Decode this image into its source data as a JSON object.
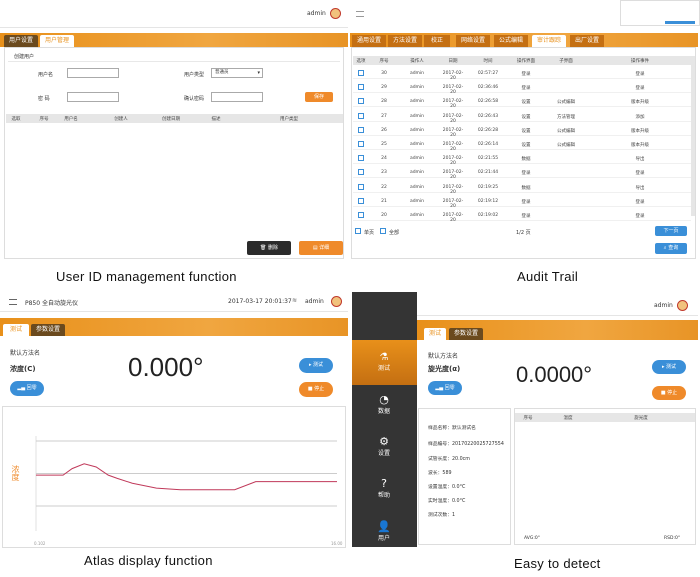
{
  "q1": {
    "user": "admin",
    "tabs": [
      "用户设置",
      "用户管理"
    ],
    "form_title": "创建用户",
    "fields": {
      "username": "用户名",
      "user_type": "用户类型",
      "user_type_value": "普通员",
      "password": "密 码",
      "confirm": "确认密码"
    },
    "save_label": "保存",
    "headers": [
      "选取",
      "序号",
      "用户名",
      "创建人",
      "创建日期",
      "描述",
      "用户类型"
    ],
    "delete_label": "删除",
    "detail_label": "详细",
    "caption": "User ID management function"
  },
  "q2": {
    "tabs": [
      "通用设置",
      "方法设置",
      "校正",
      "网络设置",
      "公式编辑",
      "审计跟踪",
      "出厂设置"
    ],
    "headers": [
      "选项",
      "序号",
      "操作人",
      "日期",
      "时间",
      "操作界面",
      "子界面",
      "操作事件"
    ],
    "rows": [
      {
        "n": "30",
        "u": "admin",
        "d": "2017-02-20",
        "t": "02:57:27",
        "s": "登录",
        "sub": "",
        "e": "登录"
      },
      {
        "n": "29",
        "u": "admin",
        "d": "2017-02-20",
        "t": "02:36:46",
        "s": "登录",
        "sub": "",
        "e": "登录"
      },
      {
        "n": "28",
        "u": "admin",
        "d": "2017-02-20",
        "t": "02:26:58",
        "s": "设置",
        "sub": "公式编辑",
        "e": "版本升级"
      },
      {
        "n": "27",
        "u": "admin",
        "d": "2017-02-20",
        "t": "02:26:43",
        "s": "设置",
        "sub": "方法管理",
        "e": "添加"
      },
      {
        "n": "26",
        "u": "admin",
        "d": "2017-02-20",
        "t": "02:26:28",
        "s": "设置",
        "sub": "公式编辑",
        "e": "版本升级"
      },
      {
        "n": "25",
        "u": "admin",
        "d": "2017-02-20",
        "t": "02:26:14",
        "s": "设置",
        "sub": "公式编辑",
        "e": "版本升级"
      },
      {
        "n": "24",
        "u": "admin",
        "d": "2017-02-20",
        "t": "02:21:55",
        "s": "数据",
        "sub": "",
        "e": "导出"
      },
      {
        "n": "23",
        "u": "admin",
        "d": "2017-02-20",
        "t": "02:21:44",
        "s": "登录",
        "sub": "",
        "e": "登录"
      },
      {
        "n": "22",
        "u": "admin",
        "d": "2017-02-20",
        "t": "02:19:25",
        "s": "数据",
        "sub": "",
        "e": "导出"
      },
      {
        "n": "21",
        "u": "admin",
        "d": "2017-02-20",
        "t": "02:19:12",
        "s": "登录",
        "sub": "",
        "e": "登录"
      },
      {
        "n": "20",
        "u": "admin",
        "d": "2017-02-20",
        "t": "02:19:02",
        "s": "登录",
        "sub": "",
        "e": "登录"
      }
    ],
    "single_page": "单页",
    "all_label": "全部",
    "page": "1/2 页",
    "next_label": "下一页",
    "search_label": "查询",
    "caption": "Audit Trail"
  },
  "q3": {
    "device": "P850 全自动旋光仪",
    "datetime": "2017-03-17 20:01:37",
    "user": "admin",
    "tabs": [
      "测试",
      "参数设置"
    ],
    "method": "默认方法名",
    "measure": "浓度(C)",
    "value": "0.000°",
    "zero_label": "回零",
    "test_label": "测试",
    "stop_label": "停止",
    "y_label": "浓度",
    "x_start": "0.102",
    "x_end": "16.00",
    "chart_data": {
      "type": "line",
      "ylim": [
        -1,
        1
      ],
      "x": [
        0,
        5,
        9,
        12,
        16,
        20,
        24,
        27,
        32,
        40,
        48,
        58,
        66,
        73,
        80,
        100
      ],
      "y": [
        -0.05,
        -0.05,
        -0.05,
        0.15,
        0.3,
        0.2,
        -0.05,
        -0.15,
        -0.3,
        -0.45,
        -0.5,
        -0.5,
        -0.5,
        -0.25,
        -0.25,
        -0.25
      ]
    },
    "caption": "Atlas display function"
  },
  "q4": {
    "user": "admin",
    "sidebar": [
      "测试",
      "数据",
      "设置",
      "帮助",
      "用户"
    ],
    "tabs": [
      "测试",
      "参数设置"
    ],
    "method": "默认方法名",
    "measure": "旋光度(α)",
    "value": "0.0000°",
    "zero_label": "回零",
    "test_label": "测试",
    "stop_label": "停止",
    "info": [
      "样品名称：默认测试名",
      "样品编号：20170220025727554",
      "试管长度：20.0cm",
      "波长：589",
      "设置温度：0.0°C",
      "实时温度：0.0°C",
      "测试次数：1"
    ],
    "headers": [
      "序号",
      "温度",
      "旋光度"
    ],
    "avg": "AVG:0°",
    "rsd": "RSD:0°",
    "caption": "Easy to detect"
  }
}
